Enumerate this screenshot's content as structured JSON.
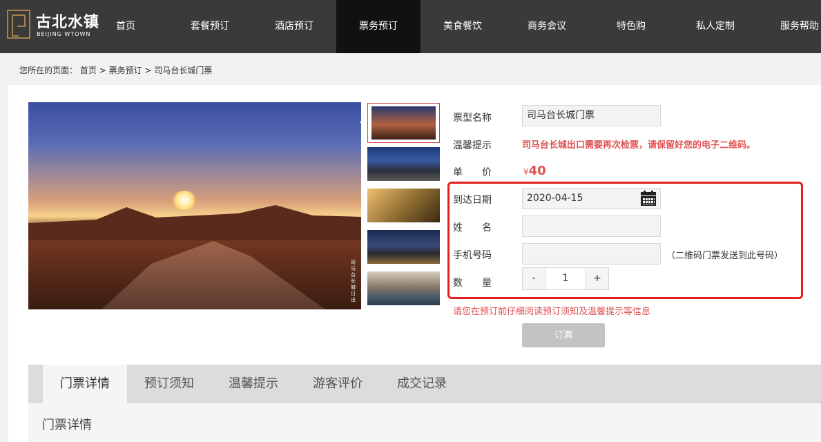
{
  "brand": {
    "name_cn": "古北水镇",
    "name_en": "BEIJING WTOWN"
  },
  "nav": {
    "items": [
      "首页",
      "套餐预订",
      "酒店预订",
      "票务预订",
      "美食餐饮",
      "商务会议",
      "特色购",
      "私人定制",
      "服务帮助"
    ],
    "active": "票务预订"
  },
  "breadcrumb": {
    "prefix": "您所在的页面：",
    "items": [
      "首页",
      "票务预订",
      "司马台长城门票"
    ],
    "separator": ">"
  },
  "gallery": {
    "watermark": "司马台长城·日出",
    "thumbnail_count": 5,
    "selected_index": 0
  },
  "form": {
    "ticket_type_label": "票型名称",
    "ticket_type_value": "司马台长城门票",
    "tip_label": "温馨提示",
    "tip_text": "司马台长城出口需要再次检票，请保留好您的电子二维码。",
    "price_label": "单　　价",
    "price_currency": "¥",
    "price_value": "40",
    "date_label": "到达日期",
    "date_value": "2020-04-15",
    "name_label": "姓　　名",
    "name_value": "",
    "phone_label": "手机号码",
    "phone_value": "",
    "phone_note": "（二维码门票发送到此号码）",
    "qty_label": "数　　量",
    "qty_minus": "-",
    "qty_value": "1",
    "qty_plus": "+",
    "notice": "请您在预订前仔细阅读预订须知及温馨提示等信息",
    "submit_label": "订满"
  },
  "colors": {
    "nav_bg": "#3a3a3a",
    "accent_red": "#e05050",
    "highlight_box": "#e51f1f"
  },
  "tabs": {
    "items": [
      "门票详情",
      "预订须知",
      "温馨提示",
      "游客评价",
      "成交记录"
    ],
    "active": "门票详情"
  },
  "tab_content": {
    "title": "门票详情"
  }
}
